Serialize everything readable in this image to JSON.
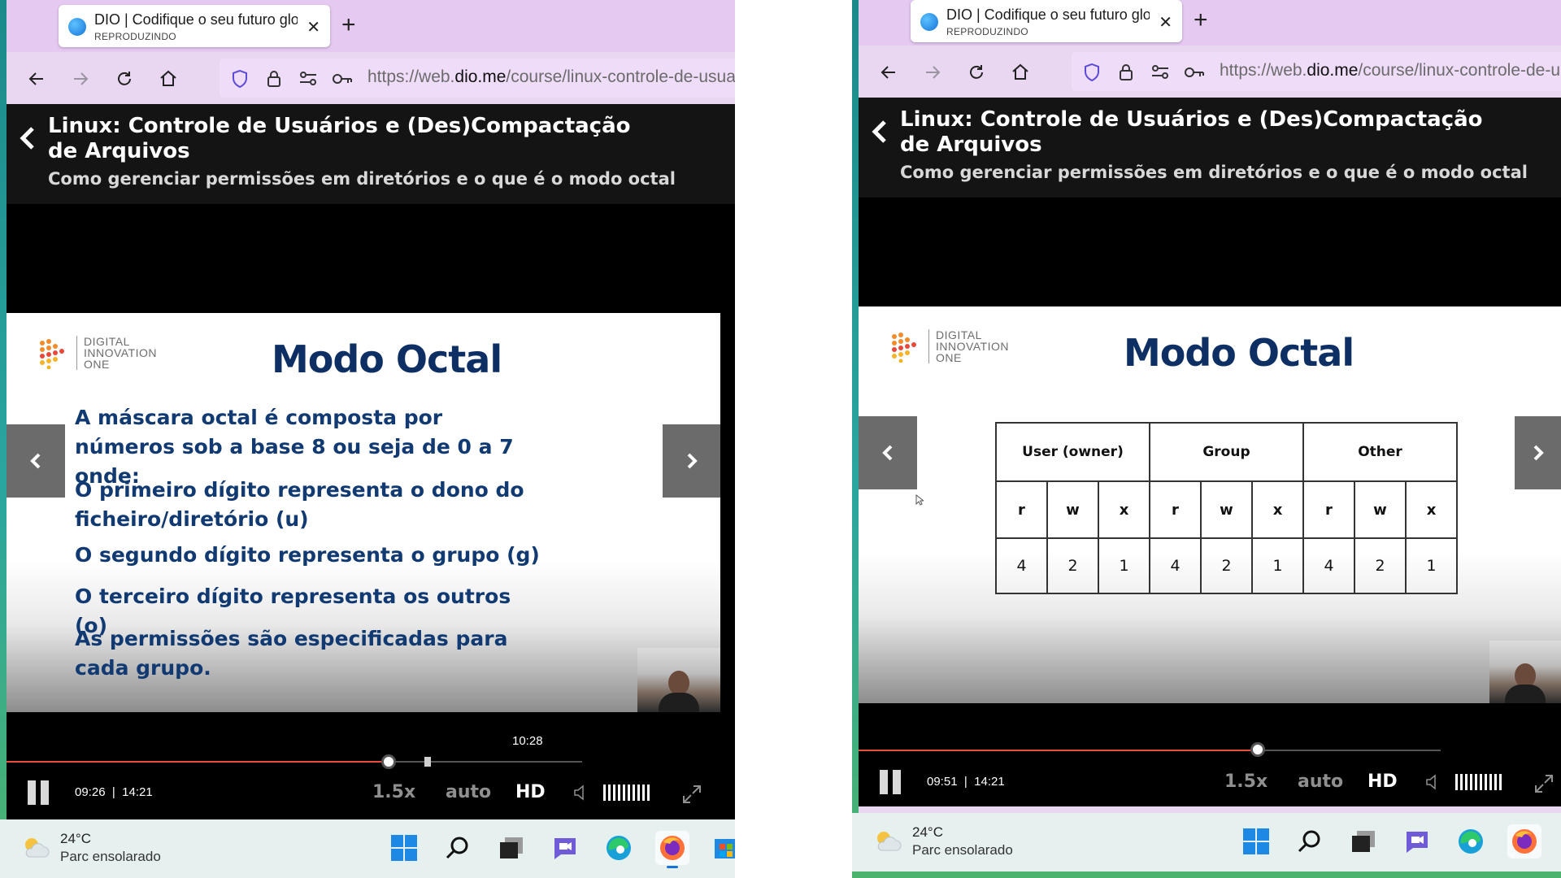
{
  "left_window": {
    "tab": {
      "title": "DIO | Codifique o seu futuro glo",
      "status": "REPRODUZINDO"
    },
    "url": {
      "prefix": "https://web.",
      "domain": "dio.me",
      "path": "/course/linux-controle-de-usua"
    },
    "course": {
      "title": "Linux: Controle de Usuários e (Des)Compactação de Arquivos",
      "subtitle": "Como gerenciar permissões em diretórios e o que é o modo octal"
    },
    "slide": {
      "logo_lines": [
        "DIGITAL",
        "INNOVATION",
        "ONE"
      ],
      "title": "Modo Octal",
      "paragraphs": [
        "A máscara octal é composta por números sob a base 8 ou seja de 0 a 7 onde:",
        "O primeiro dígito representa o dono do ficheiro/diretório (u)",
        "O segundo dígito representa o grupo (g)",
        "O terceiro dígito representa os outros (o)",
        "As permissões são especificadas para cada grupo."
      ]
    },
    "player": {
      "current_time": "09:26",
      "separator": "|",
      "duration": "14:21",
      "hover_time": "10:28",
      "progress": 0.6636,
      "hover_progress": 0.7312,
      "speed": "1.5x",
      "quality_mode": "auto",
      "quality": "HD"
    }
  },
  "right_window": {
    "tab": {
      "title": "DIO | Codifique o seu futuro glo",
      "status": "REPRODUZINDO"
    },
    "url": {
      "prefix": "https://web.",
      "domain": "dio.me",
      "path": "/course/linux-controle-de-u"
    },
    "course": {
      "title": "Linux: Controle de Usuários e (Des)Compactação de Arquivos",
      "subtitle": "Como gerenciar permissões em diretórios e o que é o modo octal"
    },
    "slide": {
      "logo_lines": [
        "DIGITAL",
        "INNOVATION",
        "ONE"
      ],
      "title": "Modo Octal",
      "table": {
        "groups": [
          "User (owner)",
          "Group",
          "Other"
        ],
        "perms": [
          "r",
          "w",
          "x",
          "r",
          "w",
          "x",
          "r",
          "w",
          "x"
        ],
        "values": [
          "4",
          "2",
          "1",
          "4",
          "2",
          "1",
          "4",
          "2",
          "1"
        ]
      }
    },
    "player": {
      "current_time": "09:51",
      "separator": "|",
      "duration": "14:21",
      "progress": 0.6861,
      "speed": "1.5x",
      "quality_mode": "auto",
      "quality": "HD"
    }
  },
  "taskbar": {
    "temperature": "24°C",
    "weather": "Parc ensolarado",
    "apps": [
      "start-icon",
      "search-icon",
      "task-view-icon",
      "chat-icon",
      "edge-icon",
      "firefox-icon",
      "store-icon"
    ]
  },
  "colors": {
    "tab_strip": "#e5c9f1",
    "slide_title": "#0d2f63",
    "slide_text": "#123a72",
    "progress": "#e74c3c"
  }
}
